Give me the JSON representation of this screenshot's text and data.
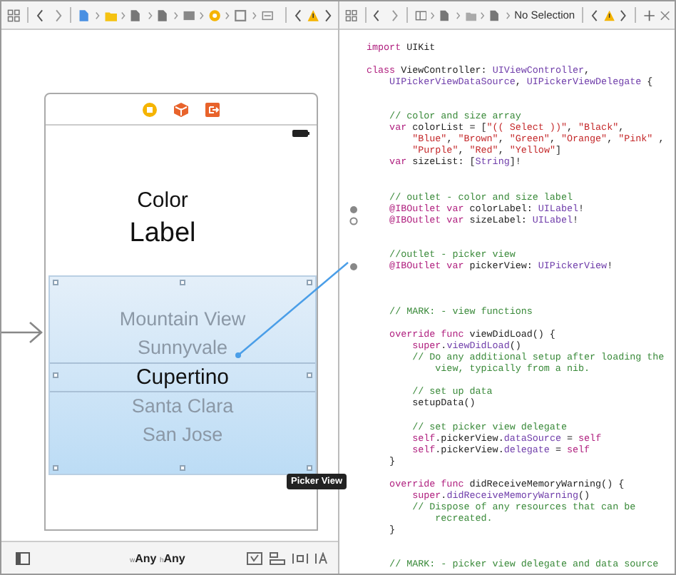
{
  "storyboard": {
    "labels": [
      {
        "text": "Color",
        "kind": "small"
      },
      {
        "text": "Label",
        "kind": "large"
      }
    ],
    "picker": {
      "rows": [
        {
          "text": "Mountain View",
          "selected": false
        },
        {
          "text": "Sunnyvale",
          "selected": false
        },
        {
          "text": "Cupertino",
          "selected": true
        },
        {
          "text": "Santa Clara",
          "selected": false
        },
        {
          "text": "San Jose",
          "selected": false
        }
      ],
      "tooltip": "Picker View"
    },
    "size_class": {
      "width_prefix": "w",
      "width": "Any",
      "height_prefix": "h",
      "height": "Any"
    }
  },
  "editor": {
    "jump_bar_text": "No Selection",
    "lines": [
      {
        "kind": "code",
        "tokens": [
          {
            "kind": "k",
            "text": "import"
          },
          {
            "kind": "p",
            "text": " UIKit"
          }
        ]
      },
      {
        "kind": "blank"
      },
      {
        "kind": "code",
        "tokens": [
          {
            "kind": "k",
            "text": "class"
          },
          {
            "kind": "p",
            "text": " ViewController: "
          },
          {
            "kind": "t",
            "text": "UIViewController"
          },
          {
            "kind": "p",
            "text": ","
          }
        ]
      },
      {
        "kind": "code",
        "tokens": [
          {
            "kind": "t",
            "text": "    UIPickerViewDataSource"
          },
          {
            "kind": "p",
            "text": ", "
          },
          {
            "kind": "t",
            "text": "UIPickerViewDelegate"
          },
          {
            "kind": "p",
            "text": " {"
          }
        ]
      },
      {
        "kind": "blank"
      },
      {
        "kind": "blank"
      },
      {
        "kind": "code",
        "tokens": [
          {
            "kind": "c",
            "text": "    // color and size array"
          }
        ]
      },
      {
        "kind": "code",
        "tokens": [
          {
            "kind": "k",
            "text": "    var"
          },
          {
            "kind": "p",
            "text": " colorList = ["
          },
          {
            "kind": "s",
            "text": "\"(( Select ))\""
          },
          {
            "kind": "p",
            "text": ", "
          },
          {
            "kind": "s",
            "text": "\"Black\""
          },
          {
            "kind": "p",
            "text": ","
          }
        ]
      },
      {
        "kind": "code",
        "tokens": [
          {
            "kind": "s",
            "text": "        \"Blue\""
          },
          {
            "kind": "p",
            "text": ", "
          },
          {
            "kind": "s",
            "text": "\"Brown\""
          },
          {
            "kind": "p",
            "text": ", "
          },
          {
            "kind": "s",
            "text": "\"Green\""
          },
          {
            "kind": "p",
            "text": ", "
          },
          {
            "kind": "s",
            "text": "\"Orange\""
          },
          {
            "kind": "p",
            "text": ", "
          },
          {
            "kind": "s",
            "text": "\"Pink\""
          },
          {
            "kind": "p",
            "text": " ,"
          }
        ]
      },
      {
        "kind": "code",
        "tokens": [
          {
            "kind": "s",
            "text": "        \"Purple\""
          },
          {
            "kind": "p",
            "text": ", "
          },
          {
            "kind": "s",
            "text": "\"Red\""
          },
          {
            "kind": "p",
            "text": ", "
          },
          {
            "kind": "s",
            "text": "\"Yellow\""
          },
          {
            "kind": "p",
            "text": "]"
          }
        ]
      },
      {
        "kind": "code",
        "tokens": [
          {
            "kind": "k",
            "text": "    var"
          },
          {
            "kind": "p",
            "text": " sizeList: ["
          },
          {
            "kind": "t",
            "text": "String"
          },
          {
            "kind": "p",
            "text": "]!"
          }
        ]
      },
      {
        "kind": "blank"
      },
      {
        "kind": "blank"
      },
      {
        "kind": "code",
        "tokens": [
          {
            "kind": "c",
            "text": "    // outlet - color and size label"
          }
        ]
      },
      {
        "kind": "code",
        "connected": true,
        "tokens": [
          {
            "kind": "k",
            "text": "    @IBOutlet var"
          },
          {
            "kind": "p",
            "text": " colorLabel: "
          },
          {
            "kind": "t",
            "text": "UILabel"
          },
          {
            "kind": "p",
            "text": "!"
          }
        ]
      },
      {
        "kind": "code",
        "connected": false,
        "tokens": [
          {
            "kind": "k",
            "text": "    @IBOutlet var"
          },
          {
            "kind": "p",
            "text": " sizeLabel: "
          },
          {
            "kind": "t",
            "text": "UILabel"
          },
          {
            "kind": "p",
            "text": "!"
          }
        ]
      },
      {
        "kind": "blank"
      },
      {
        "kind": "blank"
      },
      {
        "kind": "code",
        "tokens": [
          {
            "kind": "c",
            "text": "    //outlet - picker view"
          }
        ]
      },
      {
        "kind": "code",
        "connected": true,
        "tokens": [
          {
            "kind": "k",
            "text": "    @IBOutlet var"
          },
          {
            "kind": "p",
            "text": " pickerView: "
          },
          {
            "kind": "t",
            "text": "UIPickerView"
          },
          {
            "kind": "p",
            "text": "!"
          }
        ]
      },
      {
        "kind": "blank"
      },
      {
        "kind": "blank"
      },
      {
        "kind": "blank"
      },
      {
        "kind": "code",
        "tokens": [
          {
            "kind": "c",
            "text": "    // MARK: - view functions"
          }
        ]
      },
      {
        "kind": "blank"
      },
      {
        "kind": "code",
        "tokens": [
          {
            "kind": "k",
            "text": "    override func"
          },
          {
            "kind": "p",
            "text": " viewDidLoad() {"
          }
        ]
      },
      {
        "kind": "code",
        "tokens": [
          {
            "kind": "k",
            "text": "        super"
          },
          {
            "kind": "p",
            "text": "."
          },
          {
            "kind": "t",
            "text": "viewDidLoad"
          },
          {
            "kind": "p",
            "text": "()"
          }
        ]
      },
      {
        "kind": "code",
        "tokens": [
          {
            "kind": "c",
            "text": "        // Do any additional setup after loading the"
          }
        ]
      },
      {
        "kind": "code",
        "tokens": [
          {
            "kind": "c",
            "text": "            view, typically from a nib."
          }
        ]
      },
      {
        "kind": "blank"
      },
      {
        "kind": "code",
        "tokens": [
          {
            "kind": "c",
            "text": "        // set up data"
          }
        ]
      },
      {
        "kind": "code",
        "tokens": [
          {
            "kind": "p",
            "text": "        setupData()"
          }
        ]
      },
      {
        "kind": "blank"
      },
      {
        "kind": "code",
        "tokens": [
          {
            "kind": "c",
            "text": "        // set picker view delegate"
          }
        ]
      },
      {
        "kind": "code",
        "tokens": [
          {
            "kind": "k",
            "text": "        self"
          },
          {
            "kind": "p",
            "text": ".pickerView."
          },
          {
            "kind": "t",
            "text": "dataSource"
          },
          {
            "kind": "p",
            "text": " = "
          },
          {
            "kind": "k",
            "text": "self"
          }
        ]
      },
      {
        "kind": "code",
        "tokens": [
          {
            "kind": "k",
            "text": "        self"
          },
          {
            "kind": "p",
            "text": ".pickerView."
          },
          {
            "kind": "t",
            "text": "delegate"
          },
          {
            "kind": "p",
            "text": " = "
          },
          {
            "kind": "k",
            "text": "self"
          }
        ]
      },
      {
        "kind": "code",
        "tokens": [
          {
            "kind": "p",
            "text": "    }"
          }
        ]
      },
      {
        "kind": "blank"
      },
      {
        "kind": "code",
        "tokens": [
          {
            "kind": "k",
            "text": "    override func"
          },
          {
            "kind": "p",
            "text": " didReceiveMemoryWarning() {"
          }
        ]
      },
      {
        "kind": "code",
        "tokens": [
          {
            "kind": "k",
            "text": "        super"
          },
          {
            "kind": "p",
            "text": "."
          },
          {
            "kind": "t",
            "text": "didReceiveMemoryWarning"
          },
          {
            "kind": "p",
            "text": "()"
          }
        ]
      },
      {
        "kind": "code",
        "tokens": [
          {
            "kind": "c",
            "text": "        // Dispose of any resources that can be"
          }
        ]
      },
      {
        "kind": "code",
        "tokens": [
          {
            "kind": "c",
            "text": "            recreated."
          }
        ]
      },
      {
        "kind": "code",
        "tokens": [
          {
            "kind": "p",
            "text": "    }"
          }
        ]
      },
      {
        "kind": "blank"
      },
      {
        "kind": "blank"
      },
      {
        "kind": "code",
        "tokens": [
          {
            "kind": "c",
            "text": "    // MARK: - picker view delegate and data source"
          }
        ]
      }
    ]
  }
}
